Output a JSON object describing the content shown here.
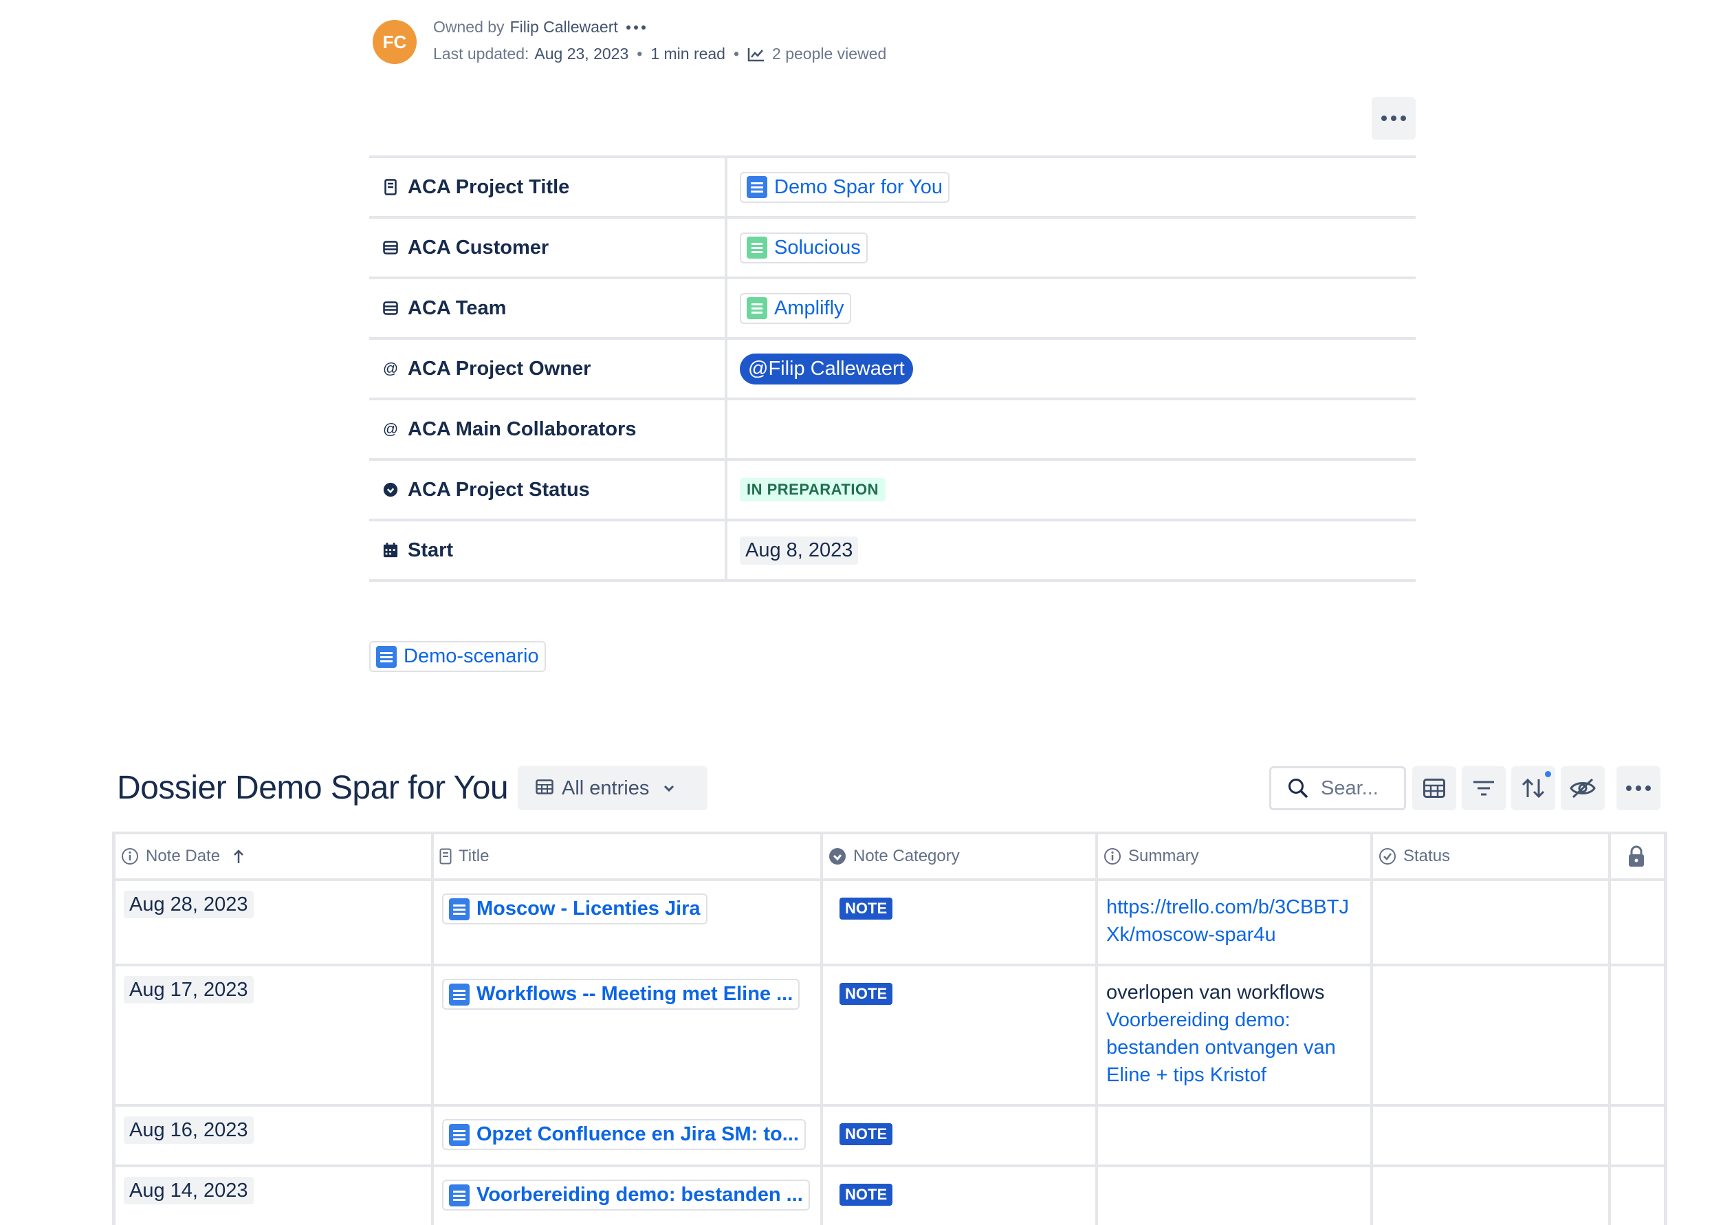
{
  "byline": {
    "avatar_initials": "FC",
    "owned_by_label": "Owned by",
    "owner_name": "Filip Callewaert",
    "last_updated_label": "Last updated:",
    "last_updated_value": "Aug 23, 2023",
    "read_time": "1 min read",
    "viewers": "2 people viewed"
  },
  "properties": {
    "rows": [
      {
        "key": "ACA Project Title",
        "icon": "page-icon",
        "value": "Demo Spar for You",
        "kind": "page-chip"
      },
      {
        "key": "ACA Customer",
        "icon": "database-icon",
        "value": "Solucious",
        "kind": "db-chip"
      },
      {
        "key": "ACA Team",
        "icon": "database-icon",
        "value": "Amplifly",
        "kind": "db-chip"
      },
      {
        "key": "ACA Project Owner",
        "icon": "at-icon",
        "value": "@Filip Callewaert",
        "kind": "mention"
      },
      {
        "key": "ACA Main Collaborators",
        "icon": "at-icon",
        "value": "",
        "kind": "empty"
      },
      {
        "key": "ACA Project Status",
        "icon": "status-icon",
        "value": "IN PREPARATION",
        "kind": "lozenge"
      },
      {
        "key": "Start",
        "icon": "calendar-icon",
        "value": "Aug 8, 2023",
        "kind": "date"
      }
    ]
  },
  "demo_link": "Demo-scenario",
  "database": {
    "title": "Dossier Demo Spar for You",
    "view_label": "All entries",
    "search_placeholder": "Sear...",
    "columns": [
      "Note Date",
      "Title",
      "Note Category",
      "Summary",
      "Status"
    ],
    "rows": [
      {
        "date": "Aug 28, 2023",
        "title": "Moscow - Licenties Jira",
        "category": "NOTE",
        "summary_text": "",
        "summary_link": "https://trello.com/b/3CBBTJXk/moscow-spar4u"
      },
      {
        "date": "Aug 17, 2023",
        "title": "Workflows -- Meeting met Eline ...",
        "category": "NOTE",
        "summary_text": "overlopen van workflows",
        "summary_link": "Voorbereiding demo: bestanden ontvangen van Eline + tips Kristof"
      },
      {
        "date": "Aug 16, 2023",
        "title": "Opzet Confluence en Jira SM: to...",
        "category": "NOTE",
        "summary_text": "",
        "summary_link": ""
      },
      {
        "date": "Aug 14, 2023",
        "title": "Voorbereiding demo: bestanden ...",
        "category": "NOTE",
        "summary_text": "",
        "summary_link": ""
      }
    ]
  }
}
